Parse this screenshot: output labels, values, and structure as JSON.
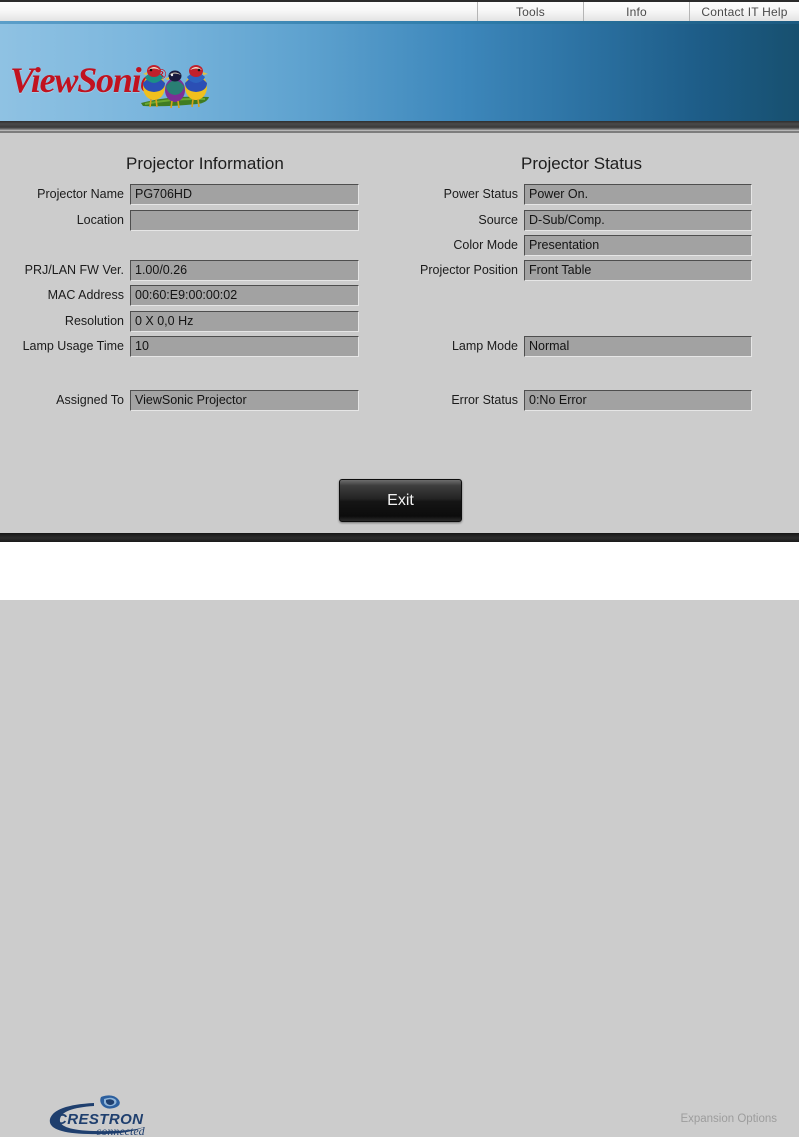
{
  "nav": {
    "items": [
      {
        "label": "Tools",
        "name": "nav-item-tools"
      },
      {
        "label": "Info",
        "name": "nav-item-info"
      },
      {
        "label": "Contact IT Help",
        "name": "nav-item-contact-it-help"
      }
    ]
  },
  "banner": {
    "brand": "ViewSonic",
    "trademark": "®",
    "logo_icon": "viewsonic-finch-birds-logo",
    "gradient_from": "#8fc2e3",
    "gradient_to": "#17506f"
  },
  "main": {
    "left_section": {
      "title": "Projector Information",
      "fields": [
        {
          "label": "Projector Name",
          "value": "PG706HD",
          "name": "projector-name"
        },
        {
          "label": "Location",
          "value": "",
          "name": "location"
        },
        {
          "label": "PRJ/LAN FW Ver.",
          "value": "1.00/0.26",
          "name": "prj-lan-fw-version"
        },
        {
          "label": "MAC Address",
          "value": "00:60:E9:00:00:02",
          "name": "mac-address"
        },
        {
          "label": "Resolution",
          "value": "0 X 0,0 Hz",
          "name": "resolution"
        },
        {
          "label": "Lamp Usage Time",
          "value": "10",
          "name": "lamp-usage-time"
        },
        {
          "label": "Assigned To",
          "value": "ViewSonic Projector",
          "name": "assigned-to"
        }
      ]
    },
    "right_section": {
      "title": "Projector Status",
      "fields": [
        {
          "label": "Power Status",
          "value": "Power On.",
          "name": "power-status"
        },
        {
          "label": "Source",
          "value": "D-Sub/Comp.",
          "name": "source"
        },
        {
          "label": "Color Mode",
          "value": "Presentation",
          "name": "color-mode"
        },
        {
          "label": "Projector Position",
          "value": "Front Table",
          "name": "projector-position"
        },
        {
          "label": "Lamp Mode",
          "value": "Normal",
          "name": "lamp-mode"
        },
        {
          "label": "Error Status",
          "value": "0:No Error",
          "name": "error-status"
        }
      ]
    },
    "exit_button": "Exit"
  },
  "footer": {
    "logo_icon": "crestron-connected-logo",
    "logo_primary": "CRESTRON",
    "logo_secondary": "connected",
    "expansion_options": "Expansion Options"
  },
  "colors": {
    "page_background": "#cccccc",
    "field_background": "#a2a2a2",
    "brand_red": "#c1121f",
    "crestron_blue": "#1f3f6e"
  }
}
